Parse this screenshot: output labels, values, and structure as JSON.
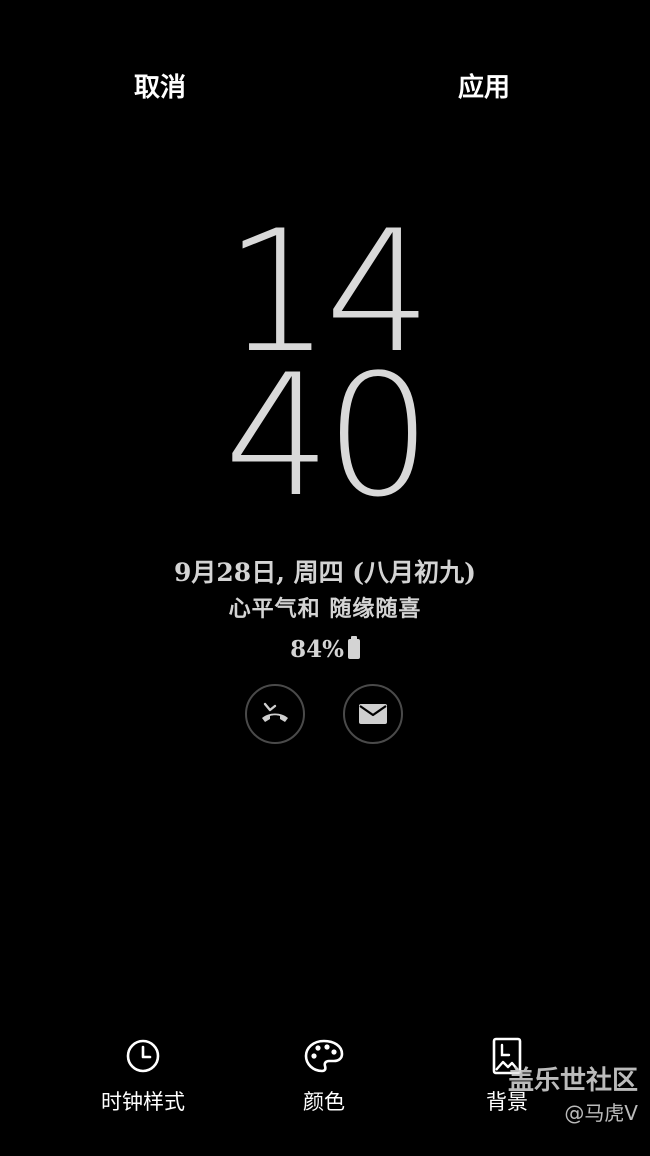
{
  "header": {
    "cancel_label": "取消",
    "apply_label": "应用"
  },
  "clock": {
    "hours": "14",
    "minutes": "40"
  },
  "info": {
    "date": "9月28日, 周四 (八月初九)",
    "motto": "心平气和  随缘随喜",
    "battery": "84%"
  },
  "notifications": [
    {
      "icon": "missed-call-icon"
    },
    {
      "icon": "mail-icon"
    }
  ],
  "toolbar": {
    "clock_style_label": "时钟样式",
    "color_label": "颜色",
    "background_label": "背景"
  },
  "watermark": {
    "line1": "盖乐世社区",
    "line2": "@马虎V"
  },
  "colors": {
    "background": "#000000",
    "clock_digits": "#d9d9d9",
    "info_text": "#d4d4d4",
    "notif_ring": "#4a4a4a"
  }
}
